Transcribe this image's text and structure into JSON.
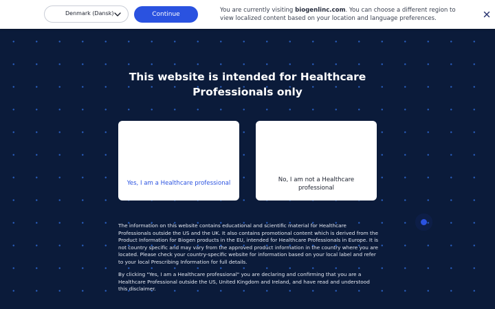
{
  "region_bar": {
    "country_select": {
      "value": "Denmark (Dansk)",
      "icon": "chevron-down-icon"
    },
    "continue_label": "Continue",
    "message": {
      "before": "You are currently visiting ",
      "site": "biogenlinc.com",
      "after": ". You can choose a different region to view localized content based on your location and language preferences."
    },
    "close_icon": "close-icon"
  },
  "main": {
    "title": "This website is intended for Healthcare Professionals only",
    "yes_label": "Yes, I am a Healthcare professional",
    "no_label": "No, I am not a Healthcare professional",
    "disclaimer_1": "The information on this website contains educational and scientific material for Healthcare Professionals outside the US and the UK. It also contains promotional content which is derived from the Product Information for Biogen products in the EU, intended for Healthcare Professionals in Europe. It is not country specific and may vary from the approved product information in the country where you are located. Please check your country-specific website for information based on your local label and refer to your local Prescribing Information for full details.",
    "disclaimer_2": "By clicking \"Yes, I am a Healthcare professional\" you are declaring and confirming that you are a Healthcare Professional outside the US, United Kingdom and Ireland, and have read and understood this disclaimer."
  },
  "colors": {
    "background": "#0b1b3a",
    "accent": "#2a52e0",
    "dots": "#2f6bd6"
  }
}
